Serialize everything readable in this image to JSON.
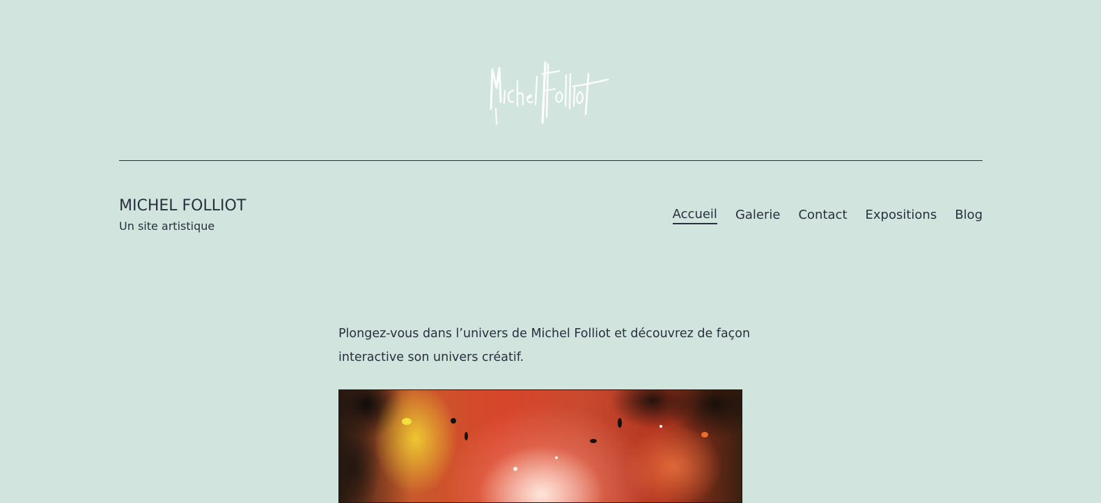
{
  "logo": {
    "text": "Michel Folliot",
    "icon": "signature-logo",
    "color": "#ffffff"
  },
  "site": {
    "title": "MICHEL FOLLIOT",
    "description": "Un site artistique"
  },
  "nav": {
    "items": [
      {
        "label": "Accueil",
        "current": true
      },
      {
        "label": "Galerie",
        "current": false
      },
      {
        "label": "Contact",
        "current": false
      },
      {
        "label": "Expositions",
        "current": false
      },
      {
        "label": "Blog",
        "current": false
      }
    ]
  },
  "content": {
    "intro": "Plongez-vous dans l’univers de Michel Folliot et découvrez de façon interactive son univers créatif."
  },
  "colors": {
    "background": "#d1e4dd",
    "text": "#28303d",
    "painting_black": "#141010",
    "painting_red": "#d8452a",
    "painting_yellow": "#f0d232",
    "painting_pink": "#ffe0d8"
  }
}
